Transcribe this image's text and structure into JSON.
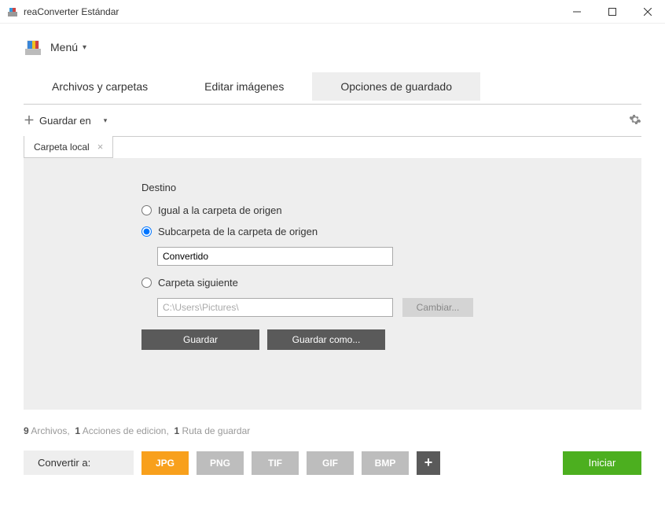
{
  "window": {
    "title": "reaConverter Estándar"
  },
  "menu": {
    "label": "Menú"
  },
  "navTabs": {
    "files": "Archivos y carpetas",
    "edit": "Editar imágenes",
    "save": "Opciones de guardado"
  },
  "toolbar": {
    "saveIn": "Guardar en"
  },
  "subTab": {
    "label": "Carpeta local"
  },
  "destination": {
    "title": "Destino",
    "sameAsSource": "Igual a la carpeta de origen",
    "subfolder": "Subcarpeta de la carpeta de origen",
    "subfolderValue": "Convertido",
    "nextFolder": "Carpeta siguiente",
    "nextFolderPath": "C:\\Users\\Pictures\\",
    "change": "Cambiar...",
    "save": "Guardar",
    "saveAs": "Guardar como..."
  },
  "status": {
    "filesCount": "9",
    "filesLabel": "Archivos,",
    "actionsCount": "1",
    "actionsLabel": "Acciones de edicion,",
    "routesCount": "1",
    "routesLabel": "Ruta de guardar"
  },
  "footer": {
    "convertTo": "Convertir a:",
    "formats": {
      "jpg": "JPG",
      "png": "PNG",
      "tif": "TIF",
      "gif": "GIF",
      "bmp": "BMP"
    },
    "start": "Iniciar"
  }
}
